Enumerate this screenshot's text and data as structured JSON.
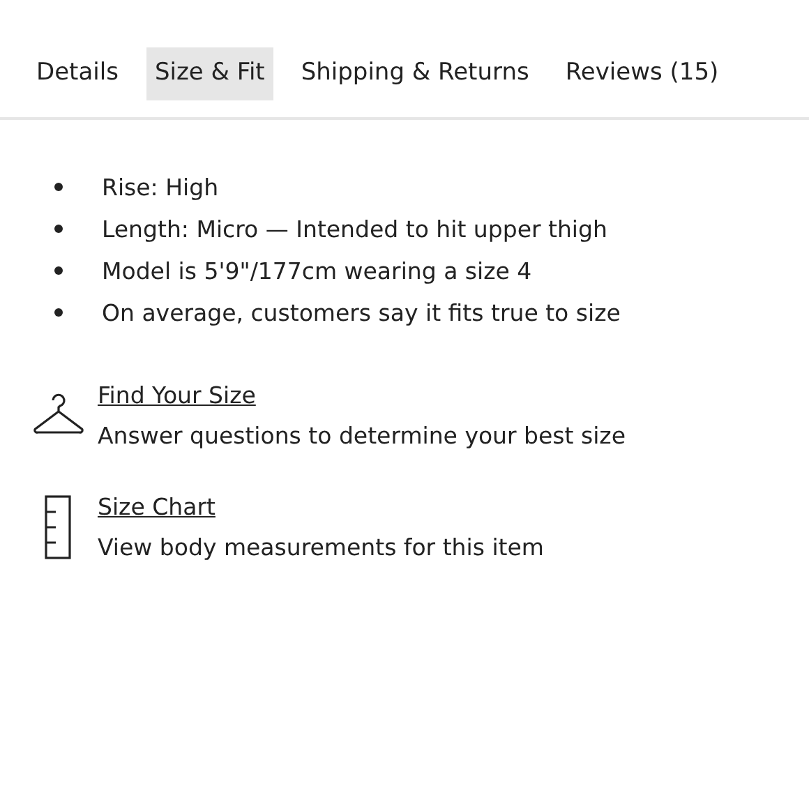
{
  "tabs": [
    {
      "label": "Details",
      "selected": false
    },
    {
      "label": "Size & Fit",
      "selected": true
    },
    {
      "label": "Shipping & Returns",
      "selected": false
    },
    {
      "label": "Reviews (15)",
      "selected": false
    }
  ],
  "bullets": [
    "Rise: High",
    "Length: Micro — Intended to hit upper thigh",
    "Model is 5'9\"/177cm wearing a size 4",
    "On average, customers say it fits true to size"
  ],
  "links": [
    {
      "kind": "hanger",
      "title": "Find Your Size",
      "description": "Answer questions to determine your best size"
    },
    {
      "kind": "ruler",
      "title": "Size Chart",
      "description": "View body measurements for this item"
    }
  ]
}
